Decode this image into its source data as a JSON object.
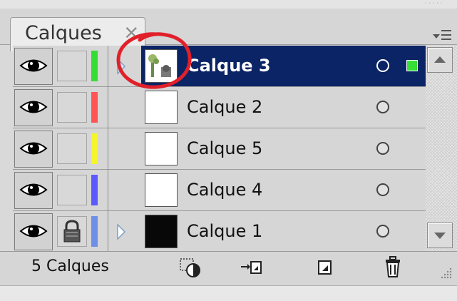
{
  "panel": {
    "tab_label": "Calques",
    "close_glyph": "×"
  },
  "layers": [
    {
      "name": "Calque 3",
      "visible": true,
      "locked": false,
      "color": "#33dd33",
      "selected": true,
      "has_children": true,
      "thumb": "tree-image"
    },
    {
      "name": "Calque 2",
      "visible": true,
      "locked": false,
      "color": "#ff5555",
      "selected": false,
      "has_children": false,
      "thumb": "blank-white"
    },
    {
      "name": "Calque 5",
      "visible": true,
      "locked": false,
      "color": "#f5f528",
      "selected": false,
      "has_children": false,
      "thumb": "blank-white"
    },
    {
      "name": "Calque 4",
      "visible": true,
      "locked": false,
      "color": "#5a5aff",
      "selected": false,
      "has_children": false,
      "thumb": "blank-white"
    },
    {
      "name": "Calque 1",
      "visible": true,
      "locked": true,
      "color": "#6d8fe8",
      "selected": false,
      "has_children": true,
      "thumb": "blank-black"
    }
  ],
  "footer": {
    "layer_count": "5 Calques",
    "buttons": [
      "make-clipping-mask-icon",
      "create-sublayer-icon",
      "new-layer-icon",
      "trash-icon"
    ]
  },
  "colors": {
    "selection": "#0b2466",
    "annotation_circle": "#e0202a",
    "selection_square": "#36e036"
  }
}
